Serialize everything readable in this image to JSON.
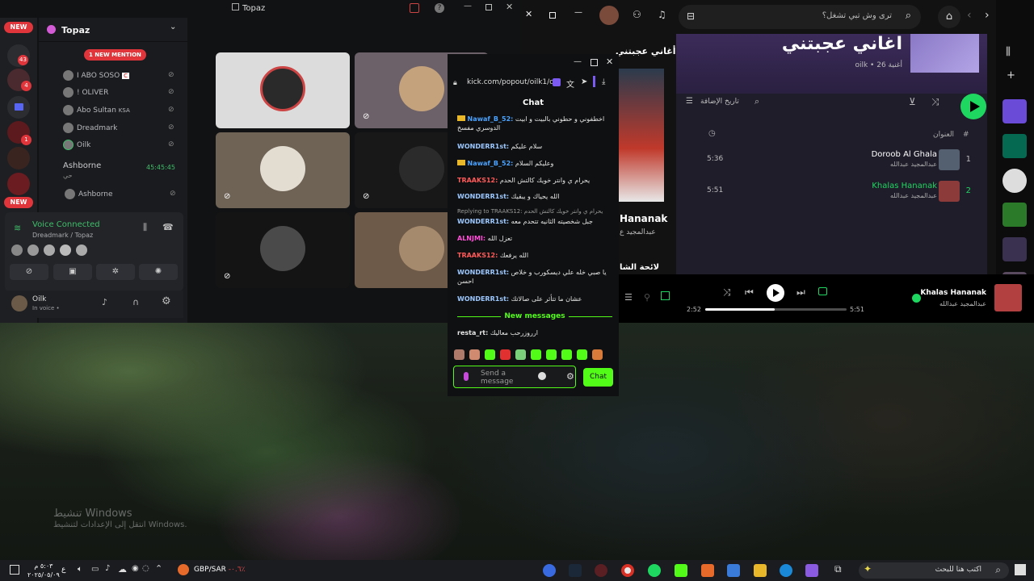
{
  "discord": {
    "window_title": "Topaz",
    "server_name": "Topaz",
    "new_label_top": "NEW",
    "new_label_bottom": "NEW",
    "mention_label": "1 NEW MENTION",
    "rail_badges": [
      "43",
      "4",
      "1"
    ],
    "voice_users": [
      {
        "name": "I ABO SOSO",
        "extra": "C"
      },
      {
        "name": "! OLIVER"
      },
      {
        "name": "Abo Sultan",
        "extra": "KSA"
      },
      {
        "name": "Dreadmark"
      },
      {
        "name": "Oilk"
      }
    ],
    "ashborne_name": "Ashborne",
    "ashborne_time": "45:45:45",
    "ashborne_subtitle": "حي",
    "ashborne_user": "Ashborne",
    "voice_status": "Voice Connected",
    "voice_channel": "Dreadmark / Topaz",
    "user_name": "Oilk",
    "user_status": "In voice •"
  },
  "kick": {
    "url": "kick.com/popout/oilk1/c",
    "chat_title": "Chat",
    "messages": [
      {
        "user": "Nawaf_B_52:",
        "text": "اخطفوني و حطوني بالبيت و ابيت الدوسري مفسخ",
        "color": "#4aa3ff"
      },
      {
        "user": "WONDERR1st:",
        "text": "سلام عليكم",
        "color": "#9cc8ff"
      },
      {
        "user": "Nawaf_B_52:",
        "text": "وعليكم السلام",
        "color": "#4aa3ff"
      },
      {
        "user": "TRAAKS12:",
        "text": "يحرام ي وانتر خويك كالتش الحدم",
        "color": "#ff5a5a"
      },
      {
        "user": "WONDERR1st:",
        "text": "الله يحياك و يبقيك",
        "color": "#9cc8ff"
      },
      {
        "reply": "Replying to TRAAKS12: يحرام ي وانتر خويك كالتش الحدم",
        "user": "WONDERR1st:",
        "text": "جبل شخصيته الثانيه تتحدم معه",
        "color": "#9cc8ff"
      },
      {
        "user": "ALNJMI:",
        "text": "تعزل الله",
        "color": "#ff4fd8"
      },
      {
        "user": "TRAAKS12:",
        "text": "الله يرفعك",
        "color": "#ff5a5a"
      },
      {
        "user": "WONDERR1st:",
        "text": "يا صبي خله علي ديسكورب و خلاص احسن",
        "color": "#9cc8ff"
      },
      {
        "user": "WONDERR1st:",
        "text": "عشان ما تتأثر على صالاتك",
        "color": "#9cc8ff"
      }
    ],
    "new_messages_label": "New messages",
    "last_message": {
      "user": "resta_rt:",
      "text": "ارروزرحب معاليك",
      "color": "#e6e6e6"
    },
    "send_placeholder": "Send a message",
    "chat_button": "Chat"
  },
  "spotify": {
    "search_placeholder": "ترى وش تبي تشغل؟",
    "playlist_title": "اغاني عجبتني",
    "playlist_sub": "oilk • 26 أغنية",
    "sort_label": "تاريخ الإضافة",
    "col_title": "العنوان",
    "col_hash": "#",
    "side_playlist_title": "أغاني عجبتني",
    "tracks": [
      {
        "no": "1",
        "name": "Doroob Al Ghala",
        "artist": "عبدالمجيد عبدالله",
        "duration": "5:36"
      },
      {
        "no": "2",
        "name": "Khalas Hananak",
        "artist": "عبدالمجيد عبدالله",
        "duration": "5:51"
      }
    ],
    "now_title_en": "Hananak",
    "now_artist": "عبدالمجيد ع",
    "queue_label": "لائحة الشا",
    "player": {
      "elapsed": "2:52",
      "total": "5:51",
      "progress": 0.49,
      "name": "Khalas Hananak",
      "artist": "عبدالمجيد عبدالله"
    }
  },
  "watermark": {
    "line1": "تنشيط Windows",
    "line2": "انتقل إلى الإعدادات لتنشيط Windows."
  },
  "taskbar": {
    "search_placeholder": "اكتب هنا للبحث",
    "clock_time": "٥:٠٣ م",
    "clock_date": "٢٠٢٥/٠٥/٠٩",
    "lang": "ع",
    "currency_pair": "GBP/SAR",
    "currency_change": "-٠.٦٪"
  },
  "colors": {
    "kick_green": "#53fc18",
    "spotify_green": "#1ed760",
    "discord_red": "#e0353b",
    "discord_green": "#3fbe6a"
  }
}
